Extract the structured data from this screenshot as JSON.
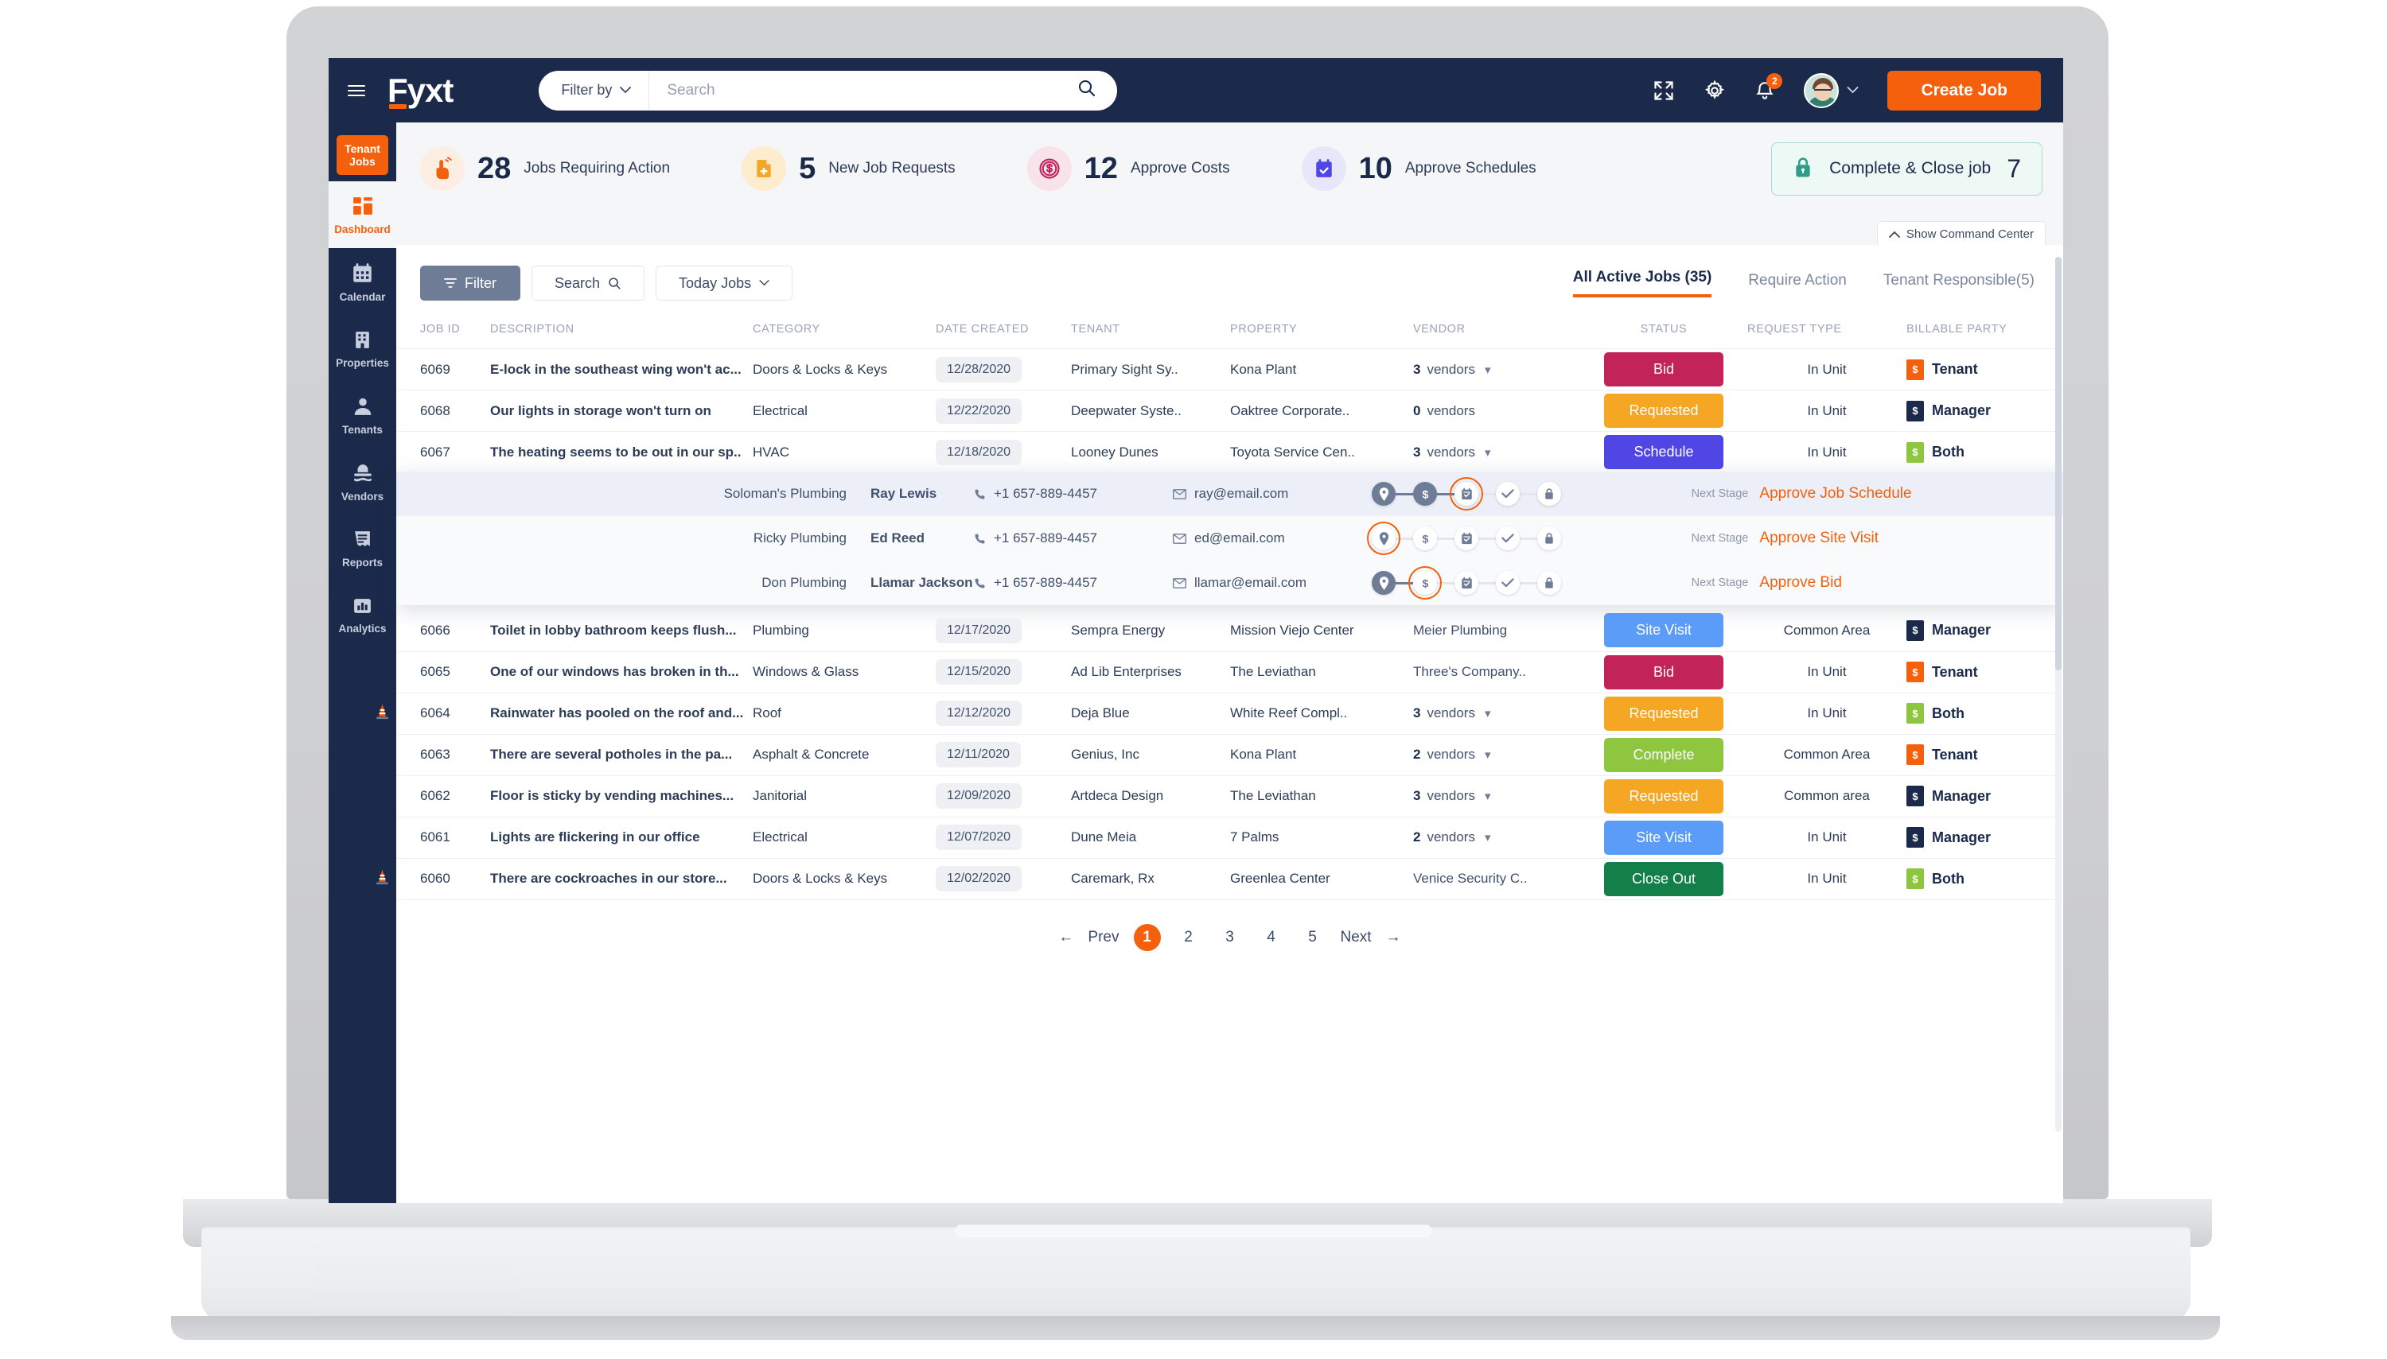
{
  "brand": {
    "name": "Fyxt"
  },
  "search": {
    "filter_by": "Filter by",
    "placeholder": "Search",
    "value": ""
  },
  "header": {
    "create_job_label": "Create Job",
    "notification_count": "2",
    "icons": [
      "expand-icon",
      "gear-icon",
      "bell-icon",
      "avatar",
      "chevron-down-icon"
    ]
  },
  "sidebar": {
    "tenant_jobs_label": "Tenant\nJobs",
    "tenant_jobs_line1": "Tenant",
    "tenant_jobs_line2": "Jobs",
    "items": [
      {
        "label": "Dashboard",
        "icon": "dashboard-icon",
        "active": true
      },
      {
        "label": "Calendar",
        "icon": "calendar-icon",
        "active": false
      },
      {
        "label": "Properties",
        "icon": "building-icon",
        "active": false
      },
      {
        "label": "Tenants",
        "icon": "person-icon",
        "active": false
      },
      {
        "label": "Vendors",
        "icon": "hardhat-icon",
        "active": false
      },
      {
        "label": "Reports",
        "icon": "document-icon",
        "active": false
      },
      {
        "label": "Analytics",
        "icon": "bar-chart-icon",
        "active": false
      }
    ]
  },
  "kpis": [
    {
      "value": "28",
      "label": "Jobs Requiring Action",
      "icon": "hand-tap-icon",
      "icon_color": "#f4600b",
      "bg": "#fdeee3"
    },
    {
      "value": "5",
      "label": "New Job Requests",
      "icon": "file-plus-icon",
      "icon_color": "#f5a623",
      "bg": "#fdeccd"
    },
    {
      "value": "12",
      "label": "Approve Costs",
      "icon": "dollar-coin-icon",
      "icon_color": "#c2245a",
      "bg": "#f9e3ea"
    },
    {
      "value": "10",
      "label": "Approve Schedules",
      "icon": "calendar-check-icon",
      "icon_color": "#4f46e5",
      "bg": "#e7e6fb"
    }
  ],
  "kpi_cta": {
    "label": "Complete & Close job",
    "value": "7",
    "icon": "lock-icon",
    "accent": "#2f9e87"
  },
  "command_center": {
    "label": "Show Command Center",
    "icon": "chevron-up-icon"
  },
  "toolbar": {
    "filter_label": "Filter",
    "search_label": "Search",
    "today_jobs_label": "Today Jobs"
  },
  "tabs": [
    {
      "label": "All Active Jobs (35)",
      "active": true
    },
    {
      "label": "Require Action",
      "active": false
    },
    {
      "label": "Tenant Responsible(5)",
      "active": false
    }
  ],
  "table": {
    "columns": [
      "JOB ID",
      "DESCRIPTION",
      "CATEGORY",
      "DATE CREATED",
      "TENANT",
      "PROPERTY",
      "VENDOR",
      "STATUS",
      "REQUEST TYPE",
      "BILLABLE PARTY"
    ],
    "status_colors": {
      "Bid": "#c2245a",
      "Requested": "#f5a623",
      "Schedule": "#4f46e5",
      "Site Visit": "#5b9cf8",
      "Complete": "#8ec63f",
      "Close Out": "#128048"
    },
    "bill_colors": {
      "Tenant": "#f4600b",
      "Manager": "#1b2a4b",
      "Both": "#8ec63f"
    },
    "rows": [
      {
        "job_id": "6069",
        "description": "E-lock in the southeast wing won't ac...",
        "category": "Doors & Locks & Keys",
        "date_created": "12/28/2020",
        "tenant": "Primary Sight Sy..",
        "property": "Kona Plant",
        "vendor": "3 vendors",
        "vendor_count": "3",
        "vendor_is_count": true,
        "status": "Bid",
        "request_type": "In Unit",
        "billable_party": "Tenant",
        "cone": false,
        "expanded": false
      },
      {
        "job_id": "6068",
        "description": "Our lights in storage won't turn on",
        "category": "Electrical",
        "date_created": "12/22/2020",
        "tenant": "Deepwater Syste..",
        "property": "Oaktree Corporate..",
        "vendor": "0 vendors",
        "vendor_count": "0",
        "vendor_is_count": true,
        "no_chevron": true,
        "status": "Requested",
        "request_type": "In Unit",
        "billable_party": "Manager",
        "cone": false,
        "expanded": false
      },
      {
        "job_id": "6067",
        "description": "The heating seems to be out in our sp..",
        "category": "HVAC",
        "date_created": "12/18/2020",
        "tenant": "Looney Dunes",
        "property": "Toyota Service Cen..",
        "vendor": "3 vendors",
        "vendor_count": "3",
        "vendor_is_count": true,
        "status": "Schedule",
        "request_type": "In Unit",
        "billable_party": "Both",
        "cone": false,
        "expanded": true
      },
      {
        "job_id": "6066",
        "description": "Toilet in lobby bathroom keeps flush...",
        "category": "Plumbing",
        "date_created": "12/17/2020",
        "tenant": "Sempra Energy",
        "property": "Mission Viejo Center",
        "vendor": "Meier Plumbing",
        "vendor_is_count": false,
        "status": "Site Visit",
        "request_type": "Common Area",
        "billable_party": "Manager",
        "cone": false,
        "expanded": false
      },
      {
        "job_id": "6065",
        "description": "One of our windows has broken in th...",
        "category": "Windows & Glass",
        "date_created": "12/15/2020",
        "tenant": "Ad Lib Enterprises",
        "property": "The Leviathan",
        "vendor": "Three's Company..",
        "vendor_is_count": false,
        "status": "Bid",
        "request_type": "In Unit",
        "billable_party": "Tenant",
        "cone": false,
        "expanded": false
      },
      {
        "job_id": "6064",
        "description": "Rainwater has pooled on the roof and...",
        "category": "Roof",
        "date_created": "12/12/2020",
        "tenant": "Deja Blue",
        "property": "White Reef Compl..",
        "vendor": "3 vendors",
        "vendor_count": "3",
        "vendor_is_count": true,
        "status": "Requested",
        "request_type": "In Unit",
        "billable_party": "Both",
        "cone": true,
        "expanded": false
      },
      {
        "job_id": "6063",
        "description": "There are several potholes in the pa...",
        "category": "Asphalt & Concrete",
        "date_created": "12/11/2020",
        "tenant": "Genius, Inc",
        "property": "Kona Plant",
        "vendor": "2 vendors",
        "vendor_count": "2",
        "vendor_is_count": true,
        "status": "Complete",
        "request_type": "Common Area",
        "billable_party": "Tenant",
        "cone": false,
        "expanded": false
      },
      {
        "job_id": "6062",
        "description": "Floor is sticky by vending machines...",
        "category": "Janitorial",
        "date_created": "12/09/2020",
        "tenant": "Artdeca Design",
        "property": "The Leviathan",
        "vendor": "3 vendors",
        "vendor_count": "3",
        "vendor_is_count": true,
        "status": "Requested",
        "request_type": "Common area",
        "billable_party": "Manager",
        "cone": false,
        "expanded": false
      },
      {
        "job_id": "6061",
        "description": "Lights are flickering in our office",
        "category": "Electrical",
        "date_created": "12/07/2020",
        "tenant": "Dune Meia",
        "property": "7 Palms",
        "vendor": "2 vendors",
        "vendor_count": "2",
        "vendor_is_count": true,
        "status": "Site Visit",
        "request_type": "In Unit",
        "billable_party": "Manager",
        "cone": false,
        "expanded": false
      },
      {
        "job_id": "6060",
        "description": "There are cockroaches in our store...",
        "category": "Doors & Locks & Keys",
        "date_created": "12/02/2020",
        "tenant": "Caremark, Rx",
        "property": "Greenlea Center",
        "vendor": "Venice Security C..",
        "vendor_is_count": false,
        "status": "Close Out",
        "request_type": "In Unit",
        "billable_party": "Both",
        "cone": true,
        "expanded": false
      }
    ]
  },
  "expanded_vendors": {
    "next_stage_label": "Next Stage",
    "stage_icons": [
      "pin-icon",
      "dollar-icon",
      "calendar-check-icon",
      "check-icon",
      "lock-icon"
    ],
    "rows": [
      {
        "company": "Soloman's Plumbing",
        "contact": "Ray Lewis",
        "phone": "+1 657-889-4457",
        "email": "ray@email.com",
        "next_stage": "Approve Job Schedule",
        "active_step": 2,
        "done_steps": 2,
        "highlight": true
      },
      {
        "company": "Ricky Plumbing",
        "contact": "Ed Reed",
        "phone": "+1 657-889-4457",
        "email": "ed@email.com",
        "next_stage": "Approve Site Visit",
        "active_step": 0,
        "done_steps": 0,
        "highlight": false
      },
      {
        "company": "Don Plumbing",
        "contact": "Llamar Jackson",
        "phone": "+1 657-889-4457",
        "email": "llamar@email.com",
        "next_stage": "Approve Bid",
        "active_step": 1,
        "done_steps": 1,
        "highlight": false
      }
    ]
  },
  "pagination": {
    "prev_label": "Prev",
    "next_label": "Next",
    "pages": [
      "1",
      "2",
      "3",
      "4",
      "5"
    ],
    "current": "1"
  }
}
